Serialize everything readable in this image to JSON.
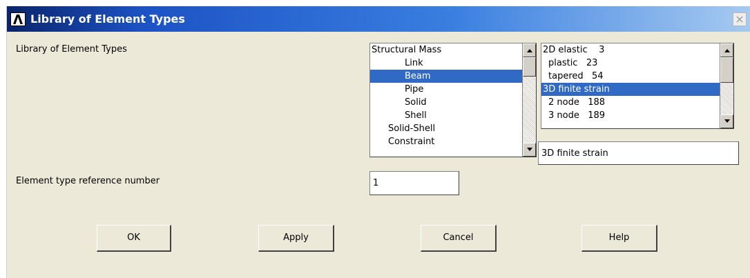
{
  "window": {
    "title": "Library of Element Types",
    "title_bar_color": "#1c52c4"
  },
  "labels": {
    "library": "Library of Element Types",
    "ref_number": "Element type reference number"
  },
  "category_list": {
    "items": [
      {
        "label": "Structural Mass",
        "indent": 0,
        "selected": false
      },
      {
        "label": "Link",
        "indent": 2,
        "selected": false
      },
      {
        "label": "Beam",
        "indent": 2,
        "selected": true
      },
      {
        "label": "Pipe",
        "indent": 2,
        "selected": false
      },
      {
        "label": "Solid",
        "indent": 2,
        "selected": false
      },
      {
        "label": "Shell",
        "indent": 2,
        "selected": false
      },
      {
        "label": "Solid-Shell",
        "indent": 1,
        "selected": false
      },
      {
        "label": "Constraint",
        "indent": 1,
        "selected": false
      }
    ]
  },
  "type_list": {
    "items": [
      {
        "label": "2D elastic    3",
        "indent": 0,
        "selected": false
      },
      {
        "label": "plastic   23",
        "indent": 1,
        "selected": false
      },
      {
        "label": "tapered   54",
        "indent": 1,
        "selected": false
      },
      {
        "label": "3D finite strain",
        "indent": 0,
        "selected": true
      },
      {
        "label": "2 node   188",
        "indent": 1,
        "selected": false
      },
      {
        "label": "3 node   189",
        "indent": 1,
        "selected": false
      }
    ]
  },
  "selected_type": "3D finite strain",
  "ref_number_value": "1",
  "buttons": {
    "ok": "OK",
    "apply": "Apply",
    "cancel": "Cancel",
    "help": "Help"
  },
  "icons": {
    "app": "ansys-logo-icon",
    "close": "close-icon",
    "scroll_up": "arrow-up-icon",
    "scroll_down": "arrow-down-icon"
  },
  "colors": {
    "selection": "#316ac5",
    "dialog_bg": "#ece9d8"
  }
}
